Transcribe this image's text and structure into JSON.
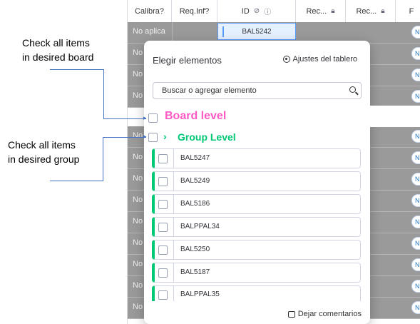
{
  "annotations": {
    "board_note_line1": "Check all items",
    "board_note_line2": "in desired board",
    "group_note_line1": "Check all items",
    "group_note_line2": "in desired group",
    "board_level": "Board level",
    "group_level": "Group Level",
    "group_chevron": "›"
  },
  "table": {
    "columns": [
      "Calibra?",
      "Req.Inf?",
      "ID",
      "Rec...",
      "Rec...",
      "F"
    ],
    "first_row_value": "No aplica",
    "row_prefix": "No",
    "selected_id": "BAL5242",
    "status_badge": "N"
  },
  "popup": {
    "title": "Elegir elementos",
    "board_settings": "Ajustes del tablero",
    "search_placeholder": "Buscar o agregar elemento",
    "items": [
      "BAL5247",
      "BAL5249",
      "BAL5186",
      "BALPPAL34",
      "BAL5250",
      "BAL5187",
      "BALPPAL35"
    ],
    "feedback": "Dejar comentarios"
  },
  "colors": {
    "board_level": "#ff5ac4",
    "group_level": "#00c875",
    "annotation_line": "#4472c4",
    "overlay": "#9a9a9a"
  }
}
